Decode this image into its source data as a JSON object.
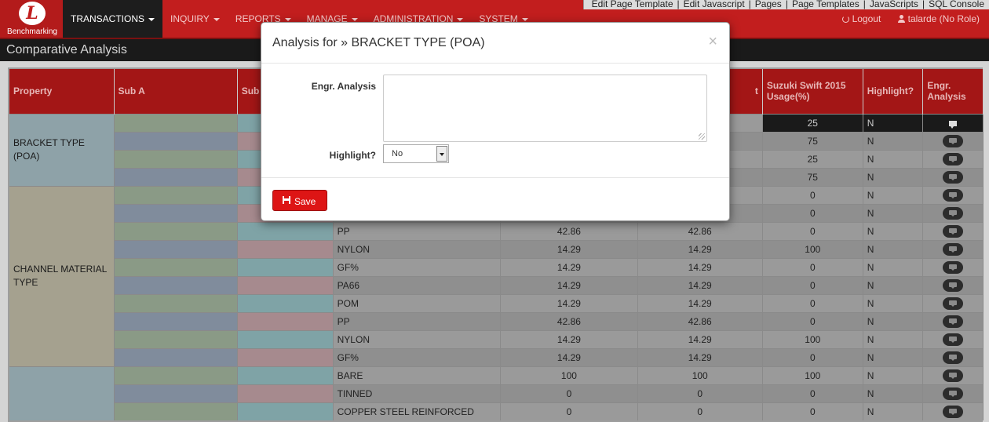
{
  "logo": {
    "letter": "L",
    "text": "Benchmarking"
  },
  "nav": [
    {
      "label": "TRANSACTIONS",
      "active": true
    },
    {
      "label": "INQUIRY"
    },
    {
      "label": "REPORTS"
    },
    {
      "label": "MANAGE"
    },
    {
      "label": "ADMINISTRATION"
    },
    {
      "label": "SYSTEM"
    }
  ],
  "dev_links": [
    "Edit Page Template",
    "Edit Javascript",
    "Pages",
    "Page Templates",
    "JavaScripts",
    "SQL Console"
  ],
  "user": {
    "logout": "Logout",
    "name": "talarde (No Role)"
  },
  "page_title": "Comparative Analysis",
  "table": {
    "headers": {
      "property": "Property",
      "sub_a": "Sub A",
      "sub_b": "Sub",
      "col4": "",
      "col5": "",
      "col6_partial": "t",
      "suzuki": "Suzuki Swift 2015 Usage(%)",
      "highlight": "Highlight?",
      "engr": "Engr. Analysis"
    },
    "groups": [
      {
        "property": "BRACKET TYPE (POA)",
        "rows": 4
      },
      {
        "property": "CHANNEL MATERIAL TYPE",
        "rows": 10
      },
      {
        "property": "",
        "rows": 3
      }
    ],
    "rows": [
      {
        "sub_c": "",
        "v1": "",
        "v2": "",
        "usage": "25",
        "highlight": "N"
      },
      {
        "sub_c": "",
        "v1": "",
        "v2": "",
        "usage": "75",
        "highlight": "N"
      },
      {
        "sub_c": "",
        "v1": "",
        "v2": "",
        "usage": "25",
        "highlight": "N"
      },
      {
        "sub_c": "",
        "v1": "",
        "v2": "",
        "usage": "75",
        "highlight": "N"
      },
      {
        "sub_c": "",
        "v1": "",
        "v2": "",
        "usage": "0",
        "highlight": "N"
      },
      {
        "sub_c": "",
        "v1": "",
        "v2": "",
        "usage": "0",
        "highlight": "N"
      },
      {
        "sub_c": "PP",
        "v1": "42.86",
        "v2": "42.86",
        "usage": "0",
        "highlight": "N"
      },
      {
        "sub_c": "NYLON",
        "v1": "14.29",
        "v2": "14.29",
        "usage": "100",
        "highlight": "N"
      },
      {
        "sub_c": "GF%",
        "v1": "14.29",
        "v2": "14.29",
        "usage": "0",
        "highlight": "N"
      },
      {
        "sub_c": "PA66",
        "v1": "14.29",
        "v2": "14.29",
        "usage": "0",
        "highlight": "N"
      },
      {
        "sub_c": "POM",
        "v1": "14.29",
        "v2": "14.29",
        "usage": "0",
        "highlight": "N"
      },
      {
        "sub_c": "PP",
        "v1": "42.86",
        "v2": "42.86",
        "usage": "0",
        "highlight": "N"
      },
      {
        "sub_c": "NYLON",
        "v1": "14.29",
        "v2": "14.29",
        "usage": "100",
        "highlight": "N"
      },
      {
        "sub_c": "GF%",
        "v1": "14.29",
        "v2": "14.29",
        "usage": "0",
        "highlight": "N"
      },
      {
        "sub_c": "BARE",
        "v1": "100",
        "v2": "100",
        "usage": "100",
        "highlight": "N"
      },
      {
        "sub_c": "TINNED",
        "v1": "0",
        "v2": "0",
        "usage": "0",
        "highlight": "N"
      },
      {
        "sub_c": "COPPER STEEL REINFORCED",
        "v1": "0",
        "v2": "0",
        "usage": "0",
        "highlight": "N"
      }
    ]
  },
  "modal": {
    "title": "Analysis for » BRACKET TYPE (POA)",
    "close": "×",
    "engr_label": "Engr. Analysis",
    "engr_value": "",
    "highlight_label": "Highlight?",
    "highlight_value": "No",
    "save_label": "Save"
  }
}
